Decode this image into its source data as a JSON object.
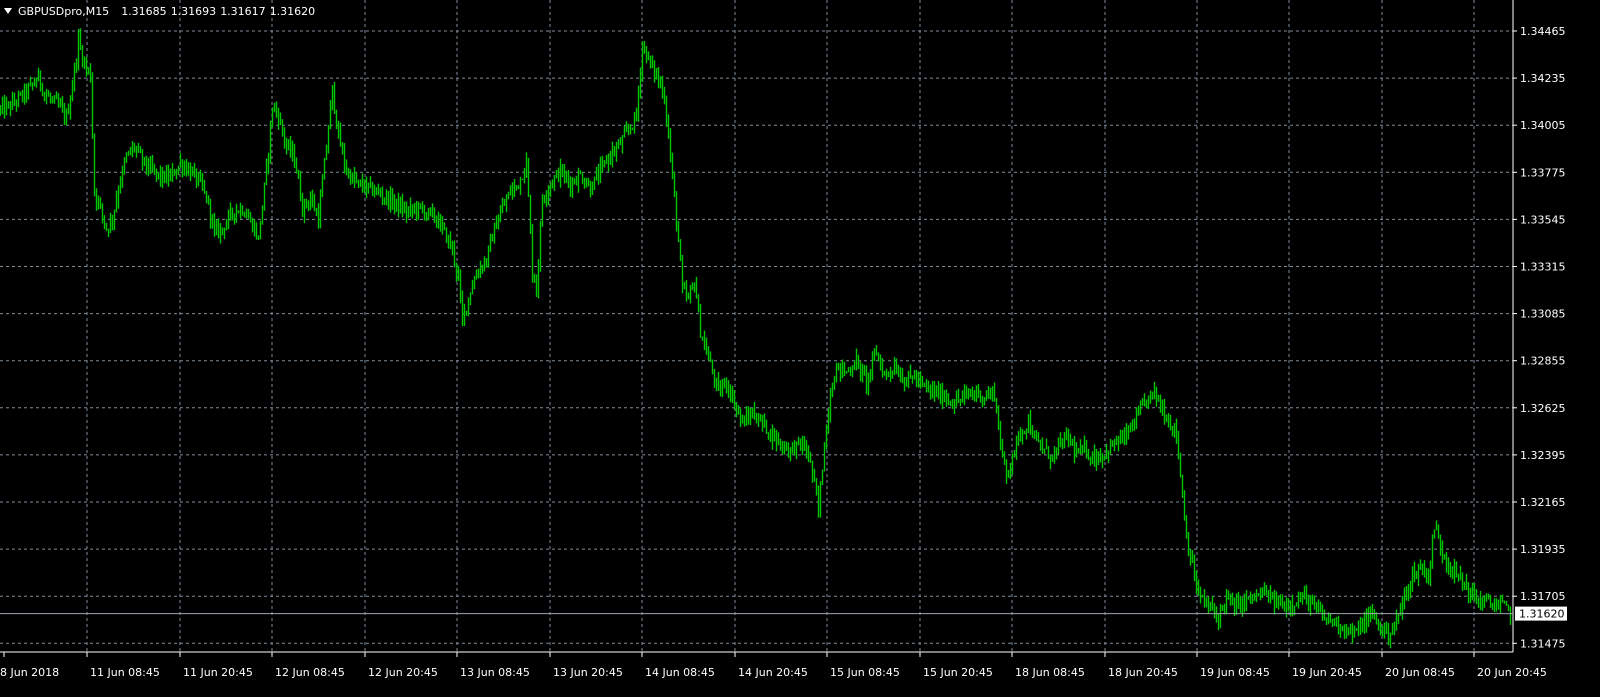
{
  "header": {
    "symbol": "GBPUSDpro,M15",
    "open": "1.31685",
    "high": "1.31693",
    "low": "1.31617",
    "close": "1.31620"
  },
  "colors": {
    "background": "#000000",
    "bars": "#00c800",
    "grid": "#7f8c9a",
    "axis": "#ffffff",
    "bid_line": "#a0a7b0"
  },
  "current_price_label": "1.31620",
  "chart_data": {
    "type": "line",
    "title": "",
    "xlabel": "",
    "ylabel": "",
    "y_ticks": [
      "1.34465",
      "1.34235",
      "1.34005",
      "1.33775",
      "1.33545",
      "1.33315",
      "1.33085",
      "1.32855",
      "1.32625",
      "1.32395",
      "1.32165",
      "1.31935",
      "1.31705",
      "1.31475"
    ],
    "x_ticks": [
      "8 Jun 2018",
      "11 Jun 08:45",
      "11 Jun 20:45",
      "12 Jun 08:45",
      "12 Jun 20:45",
      "13 Jun 08:45",
      "13 Jun 20:45",
      "14 Jun 08:45",
      "14 Jun 20:45",
      "15 Jun 08:45",
      "15 Jun 20:45",
      "18 Jun 08:45",
      "18 Jun 20:45",
      "19 Jun 08:45",
      "19 Jun 20:45",
      "20 Jun 08:45",
      "20 Jun 20:45"
    ],
    "ylim": [
      1.3137,
      1.3458
    ],
    "grid": true,
    "current_price": 1.3162,
    "series": [
      {
        "values": [
          [
            0,
            1.3408
          ],
          [
            10,
            1.341
          ],
          [
            22,
            1.3415
          ],
          [
            32,
            1.342
          ],
          [
            38,
            1.3424
          ],
          [
            45,
            1.3415
          ],
          [
            58,
            1.341
          ],
          [
            66,
            1.3404
          ],
          [
            72,
            1.342
          ],
          [
            78,
            1.3442
          ],
          [
            84,
            1.343
          ],
          [
            90,
            1.3425
          ],
          [
            94,
            1.3368
          ],
          [
            100,
            1.336
          ],
          [
            106,
            1.335
          ],
          [
            112,
            1.3355
          ],
          [
            118,
            1.337
          ],
          [
            126,
            1.3385
          ],
          [
            134,
            1.339
          ],
          [
            142,
            1.3383
          ],
          [
            152,
            1.3378
          ],
          [
            160,
            1.3375
          ],
          [
            170,
            1.3375
          ],
          [
            180,
            1.3382
          ],
          [
            190,
            1.3378
          ],
          [
            200,
            1.3372
          ],
          [
            208,
            1.3362
          ],
          [
            214,
            1.3348
          ],
          [
            222,
            1.335
          ],
          [
            232,
            1.3358
          ],
          [
            242,
            1.336
          ],
          [
            252,
            1.3352
          ],
          [
            258,
            1.3345
          ],
          [
            266,
            1.3378
          ],
          [
            272,
            1.341
          ],
          [
            278,
            1.3405
          ],
          [
            286,
            1.339
          ],
          [
            294,
            1.3385
          ],
          [
            302,
            1.336
          ],
          [
            310,
            1.3365
          ],
          [
            318,
            1.3355
          ],
          [
            326,
            1.339
          ],
          [
            332,
            1.3418
          ],
          [
            338,
            1.3395
          ],
          [
            346,
            1.3378
          ],
          [
            356,
            1.3372
          ],
          [
            366,
            1.337
          ],
          [
            376,
            1.3368
          ],
          [
            386,
            1.3365
          ],
          [
            396,
            1.3362
          ],
          [
            406,
            1.3358
          ],
          [
            416,
            1.336
          ],
          [
            426,
            1.3358
          ],
          [
            436,
            1.3355
          ],
          [
            444,
            1.3348
          ],
          [
            452,
            1.334
          ],
          [
            458,
            1.3325
          ],
          [
            462,
            1.3305
          ],
          [
            470,
            1.332
          ],
          [
            478,
            1.333
          ],
          [
            486,
            1.3335
          ],
          [
            494,
            1.335
          ],
          [
            502,
            1.336
          ],
          [
            510,
            1.3368
          ],
          [
            518,
            1.3372
          ],
          [
            526,
            1.3382
          ],
          [
            532,
            1.333
          ],
          [
            536,
            1.332
          ],
          [
            542,
            1.3365
          ],
          [
            550,
            1.3372
          ],
          [
            560,
            1.3378
          ],
          [
            570,
            1.3372
          ],
          [
            580,
            1.3376
          ],
          [
            590,
            1.337
          ],
          [
            600,
            1.3378
          ],
          [
            608,
            1.3385
          ],
          [
            618,
            1.339
          ],
          [
            628,
            1.3398
          ],
          [
            636,
            1.3405
          ],
          [
            642,
            1.344
          ],
          [
            650,
            1.343
          ],
          [
            656,
            1.3425
          ],
          [
            664,
            1.3415
          ],
          [
            670,
            1.3385
          ],
          [
            676,
            1.3355
          ],
          [
            682,
            1.332
          ],
          [
            688,
            1.3315
          ],
          [
            694,
            1.3325
          ],
          [
            700,
            1.33
          ],
          [
            706,
            1.329
          ],
          [
            712,
            1.328
          ],
          [
            718,
            1.327
          ],
          [
            726,
            1.3275
          ],
          [
            734,
            1.3265
          ],
          [
            742,
            1.3255
          ],
          [
            752,
            1.326
          ],
          [
            762,
            1.3255
          ],
          [
            770,
            1.325
          ],
          [
            780,
            1.3245
          ],
          [
            790,
            1.3242
          ],
          [
            800,
            1.3245
          ],
          [
            808,
            1.324
          ],
          [
            814,
            1.3225
          ],
          [
            818,
            1.3212
          ],
          [
            824,
            1.3245
          ],
          [
            830,
            1.327
          ],
          [
            836,
            1.3282
          ],
          [
            846,
            1.328
          ],
          [
            856,
            1.3285
          ],
          [
            866,
            1.3275
          ],
          [
            876,
            1.329
          ],
          [
            884,
            1.3278
          ],
          [
            894,
            1.3283
          ],
          [
            904,
            1.3276
          ],
          [
            914,
            1.3278
          ],
          [
            924,
            1.3272
          ],
          [
            934,
            1.327
          ],
          [
            944,
            1.3268
          ],
          [
            954,
            1.3265
          ],
          [
            964,
            1.3268
          ],
          [
            974,
            1.327
          ],
          [
            984,
            1.3268
          ],
          [
            994,
            1.327
          ],
          [
            1000,
            1.3245
          ],
          [
            1006,
            1.3228
          ],
          [
            1012,
            1.324
          ],
          [
            1020,
            1.325
          ],
          [
            1028,
            1.3256
          ],
          [
            1036,
            1.3245
          ],
          [
            1044,
            1.3242
          ],
          [
            1052,
            1.3238
          ],
          [
            1060,
            1.3245
          ],
          [
            1068,
            1.3248
          ],
          [
            1076,
            1.324
          ],
          [
            1084,
            1.3242
          ],
          [
            1094,
            1.3238
          ],
          [
            1104,
            1.324
          ],
          [
            1114,
            1.3245
          ],
          [
            1124,
            1.3248
          ],
          [
            1134,
            1.3255
          ],
          [
            1144,
            1.3265
          ],
          [
            1154,
            1.327
          ],
          [
            1162,
            1.3262
          ],
          [
            1170,
            1.3255
          ],
          [
            1176,
            1.325
          ],
          [
            1180,
            1.323
          ],
          [
            1186,
            1.32
          ],
          [
            1190,
            1.319
          ],
          [
            1196,
            1.3175
          ],
          [
            1202,
            1.3168
          ],
          [
            1210,
            1.3165
          ],
          [
            1218,
            1.316
          ],
          [
            1226,
            1.317
          ],
          [
            1234,
            1.3165
          ],
          [
            1244,
            1.3168
          ],
          [
            1254,
            1.317
          ],
          [
            1264,
            1.3172
          ],
          [
            1274,
            1.3168
          ],
          [
            1284,
            1.3166
          ],
          [
            1294,
            1.3168
          ],
          [
            1304,
            1.317
          ],
          [
            1314,
            1.3165
          ],
          [
            1324,
            1.316
          ],
          [
            1334,
            1.3158
          ],
          [
            1344,
            1.3155
          ],
          [
            1354,
            1.3152
          ],
          [
            1364,
            1.3158
          ],
          [
            1372,
            1.3162
          ],
          [
            1380,
            1.3155
          ],
          [
            1388,
            1.3152
          ],
          [
            1396,
            1.3158
          ],
          [
            1404,
            1.317
          ],
          [
            1412,
            1.318
          ],
          [
            1420,
            1.3185
          ],
          [
            1428,
            1.318
          ],
          [
            1434,
            1.3205
          ],
          [
            1440,
            1.3195
          ],
          [
            1446,
            1.3188
          ],
          [
            1454,
            1.3182
          ],
          [
            1462,
            1.3178
          ],
          [
            1470,
            1.3172
          ],
          [
            1478,
            1.3168
          ],
          [
            1486,
            1.3168
          ],
          [
            1494,
            1.3166
          ],
          [
            1502,
            1.3166
          ],
          [
            1510,
            1.3162
          ]
        ]
      }
    ]
  }
}
